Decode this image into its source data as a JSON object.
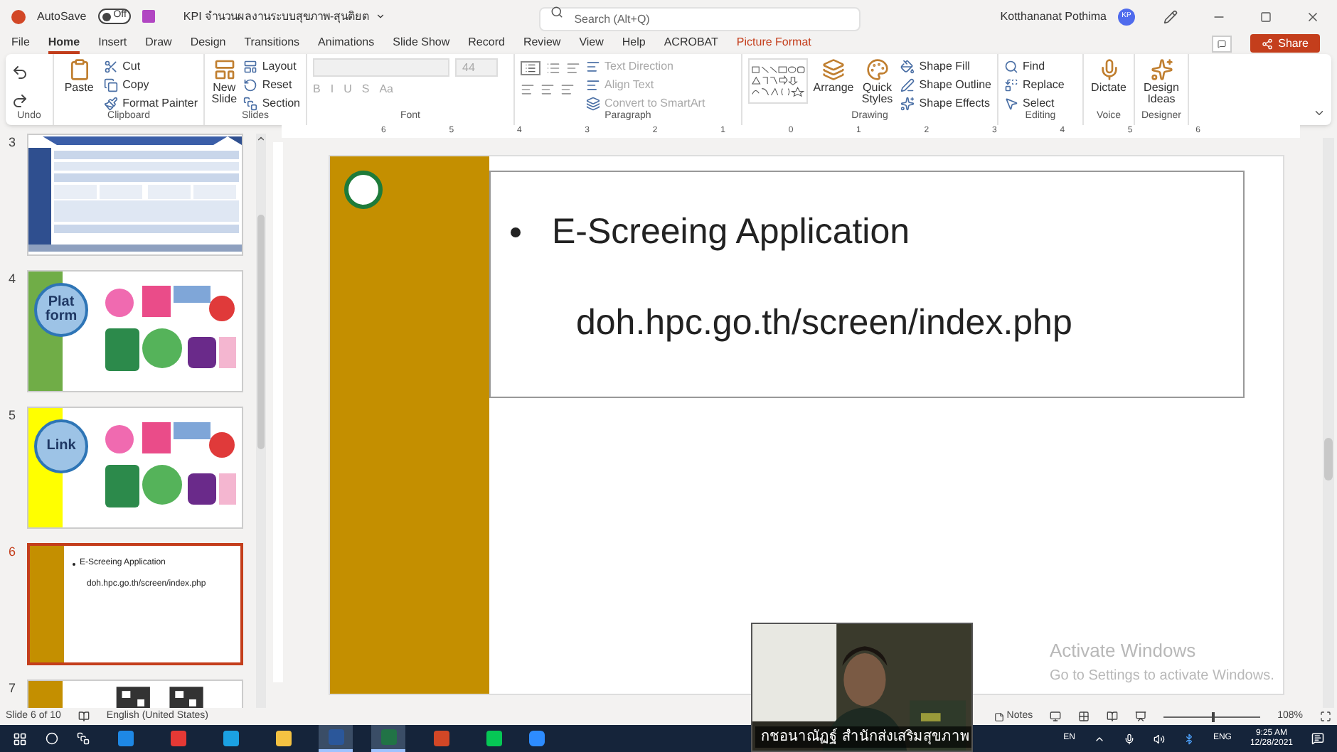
{
  "title_bar": {
    "autosave_label": "AutoSave",
    "autosave": {
      "label": "Off",
      "on": false
    },
    "document_title": "KPI จำนวนผลงานระบบสุขภาพ-สุนติยต",
    "search": {
      "placeholder": "Search (Alt+Q)"
    },
    "user_name": "Kotthananat Pothima",
    "user_initials": "KP"
  },
  "menu_tabs": [
    {
      "label": "File",
      "selected": false,
      "kind": "normal"
    },
    {
      "label": "Home",
      "selected": true,
      "kind": "normal"
    },
    {
      "label": "Insert",
      "selected": false,
      "kind": "normal"
    },
    {
      "label": "Draw",
      "selected": false,
      "kind": "normal"
    },
    {
      "label": "Design",
      "selected": false,
      "kind": "normal"
    },
    {
      "label": "Transitions",
      "selected": false,
      "kind": "normal"
    },
    {
      "label": "Animations",
      "selected": false,
      "kind": "normal"
    },
    {
      "label": "Slide Show",
      "selected": false,
      "kind": "normal"
    },
    {
      "label": "Record",
      "selected": false,
      "kind": "normal"
    },
    {
      "label": "Review",
      "selected": false,
      "kind": "normal"
    },
    {
      "label": "View",
      "selected": false,
      "kind": "normal"
    },
    {
      "label": "Help",
      "selected": false,
      "kind": "normal"
    },
    {
      "label": "ACROBAT",
      "selected": false,
      "kind": "normal"
    },
    {
      "label": "Picture Format",
      "selected": false,
      "kind": "contextual"
    }
  ],
  "share_button": "Share",
  "ribbon_groups": [
    {
      "label": "Undo"
    },
    {
      "label": "Clipboard",
      "items": [
        {
          "label": "Paste",
          "kind": "large",
          "disabled": false
        },
        {
          "label": "Cut",
          "kind": "small",
          "disabled": false
        },
        {
          "label": "Copy",
          "kind": "small",
          "disabled": false
        },
        {
          "label": "Format Painter",
          "kind": "small",
          "disabled": false
        }
      ]
    },
    {
      "label": "Slides",
      "items": [
        {
          "label": "New Slide",
          "kind": "large",
          "disabled": false
        },
        {
          "label": "Layout",
          "kind": "small",
          "disabled": false
        },
        {
          "label": "Reset",
          "kind": "small",
          "disabled": false
        },
        {
          "label": "Section",
          "kind": "small",
          "disabled": false
        }
      ]
    },
    {
      "label": "Font",
      "items": [
        {
          "label": "44",
          "kind": "font",
          "disabled": true
        }
      ]
    },
    {
      "label": "Paragraph",
      "items": [
        {
          "label": "Text Direction",
          "kind": "small",
          "disabled": true
        },
        {
          "label": "Align Text",
          "kind": "small",
          "disabled": true
        },
        {
          "label": "Convert to SmartArt",
          "kind": "small",
          "disabled": true
        }
      ]
    },
    {
      "label": "Drawing",
      "items": [
        {
          "kind": "gallery"
        },
        {
          "label": "Arrange",
          "kind": "large",
          "disabled": false
        },
        {
          "label": "Quick Styles",
          "kind": "large",
          "disabled": false
        },
        {
          "label": "Shape Fill",
          "kind": "small",
          "disabled": false
        },
        {
          "label": "Shape Outline",
          "kind": "small",
          "disabled": false
        },
        {
          "label": "Shape Effects",
          "kind": "small",
          "disabled": false
        }
      ]
    },
    {
      "label": "Editing",
      "items": [
        {
          "label": "Find",
          "kind": "small",
          "disabled": false
        },
        {
          "label": "Replace",
          "kind": "small",
          "disabled": false
        },
        {
          "label": "Select",
          "kind": "small",
          "disabled": false
        }
      ]
    },
    {
      "label": "Voice",
      "items": [
        {
          "label": "Dictate",
          "kind": "large",
          "disabled": false
        }
      ]
    },
    {
      "label": "Designer",
      "items": [
        {
          "label": "Design Ideas",
          "kind": "large",
          "disabled": false
        }
      ]
    }
  ],
  "font_buttons": [
    "B",
    "I",
    "U",
    "S",
    "Aa"
  ],
  "slide_thumbnails": [
    {
      "number": "3",
      "selected": false,
      "kind": "table",
      "color": "#2f4f8f"
    },
    {
      "number": "4",
      "selected": false,
      "kind": "circle",
      "color": "#70ad47",
      "title": "Plat form"
    },
    {
      "number": "5",
      "selected": false,
      "kind": "circle",
      "color": "#ffff00",
      "title": "Link"
    },
    {
      "number": "6",
      "selected": true,
      "kind": "text",
      "color": "#c48f00",
      "bullet": "E-Screeing Application",
      "url": "doh.hpc.go.th/screen/index.php"
    },
    {
      "number": "7",
      "selected": false,
      "kind": "qr",
      "color": "#c48f00"
    }
  ],
  "slide": {
    "bullet": "E-Screeing Application",
    "url": "doh.hpc.go.th/screen/index.php"
  },
  "ruler_numbers": [
    "6",
    "5",
    "4",
    "3",
    "2",
    "1",
    "0",
    "1",
    "2",
    "3",
    "4",
    "5",
    "6"
  ],
  "activation_notice": {
    "title": "Activate Windows",
    "message": "Go to Settings to activate Windows."
  },
  "video_overlay": {
    "caption": "กชอนาณัฏฐ์ สำนักส่งเสริมสุขภาพ"
  },
  "status_bar": {
    "slide_count": "Slide 6 of 10",
    "language": "English (United States)",
    "notes": "Notes",
    "zoom": {
      "level": 0.5
    },
    "zoom_reading": "108%"
  },
  "taskbar": {
    "apps": [
      {
        "active": false
      },
      {
        "active": false
      },
      {
        "active": false
      },
      {
        "active": false
      },
      {
        "active": true
      },
      {
        "active": true
      },
      {
        "active": false
      },
      {
        "active": false
      }
    ],
    "input_language": "EN",
    "keyboard": "ENG",
    "time": "9:25 AM",
    "date": "12/28/2021"
  }
}
